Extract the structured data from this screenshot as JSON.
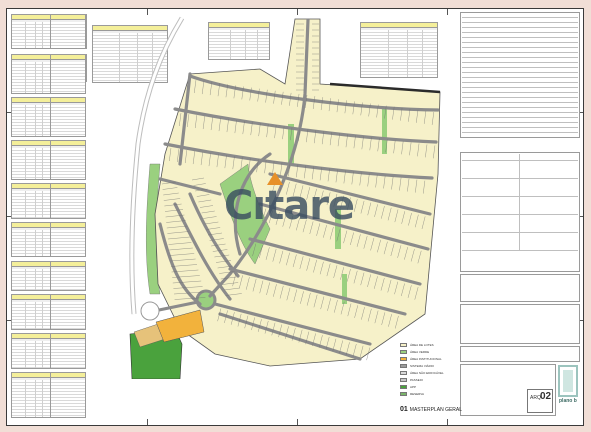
{
  "watermark": {
    "text_pre": "C",
    "text_i": "ı",
    "text_post": "tare",
    "accent_color": "#e7912a",
    "text_color": "#374b5f"
  },
  "drawing": {
    "number": "01",
    "title": "MASTERPLAN GERAL",
    "arq_label": "ARQ",
    "sheet_number": "02",
    "logo_text": "plano b"
  },
  "legend": {
    "items": [
      {
        "label": "ÁREA DE LOTES",
        "color": "#f6f1c9"
      },
      {
        "label": "ÁREA VERDE",
        "color": "#9ad07f"
      },
      {
        "label": "ÁREA INSTITUCIONAL",
        "color": "#f2b23c"
      },
      {
        "label": "SISTEMA VIÁRIO",
        "color": "#9c9c9c"
      },
      {
        "label": "ÁREA NÃO EDIFICÁVEL",
        "color": "#d9d9d9"
      },
      {
        "label": "PASSEIO",
        "color": "#c8c8c8"
      },
      {
        "label": "APP",
        "color": "#4aa23d"
      },
      {
        "label": "RESERVA",
        "color": "#7ab56a"
      }
    ]
  },
  "colors": {
    "lot": "#f6f1c9",
    "road": "#8b8b8b",
    "green": "#9ad07f",
    "app": "#4aa23d",
    "institutional": "#f2b23c",
    "lot_stroke": "#6e6e6e"
  }
}
